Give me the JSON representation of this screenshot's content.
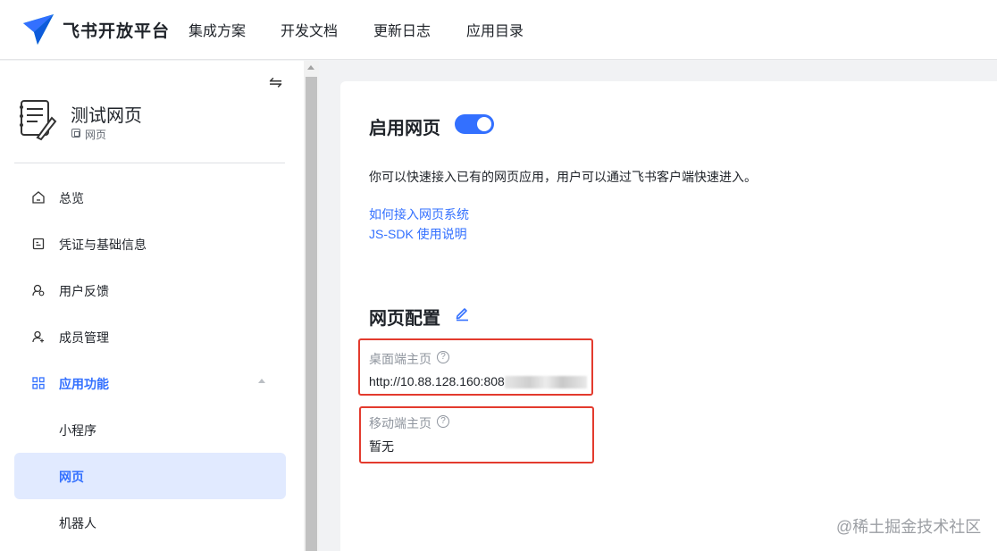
{
  "header": {
    "brand": "飞书开放平台",
    "nav": [
      "集成方案",
      "开发文档",
      "更新日志",
      "应用目录"
    ]
  },
  "sidebar": {
    "app_name": "测试网页",
    "app_type": "网页",
    "menu": [
      {
        "label": "总览",
        "icon": "home-icon"
      },
      {
        "label": "凭证与基础信息",
        "icon": "credential-icon"
      },
      {
        "label": "用户反馈",
        "icon": "feedback-icon"
      },
      {
        "label": "成员管理",
        "icon": "member-icon"
      },
      {
        "label": "应用功能",
        "icon": "grid-icon"
      }
    ],
    "submenu": [
      {
        "label": "小程序"
      },
      {
        "label": "网页"
      },
      {
        "label": "机器人"
      }
    ]
  },
  "main": {
    "enable_title": "启用网页",
    "enabled": true,
    "description": "你可以快速接入已有的网页应用，用户可以通过飞书客户端快速进入。",
    "links": [
      "如何接入网页系统",
      "JS-SDK 使用说明"
    ],
    "config_title": "网页配置",
    "desktop_label": "桌面端主页",
    "desktop_value": "http://10.88.128.160:808",
    "mobile_label": "移动端主页",
    "mobile_value": "暂无"
  },
  "watermark": "@稀土掘金技术社区",
  "colors": {
    "accent": "#3370ff",
    "highlight_box": "#e33b2e"
  }
}
